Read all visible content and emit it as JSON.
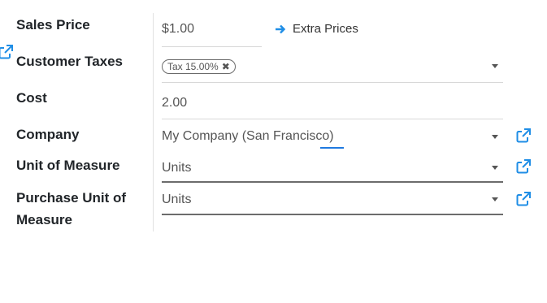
{
  "fields": {
    "sales_price": {
      "label": "Sales Price",
      "value": "$1.00"
    },
    "customer_taxes": {
      "label": "Customer Taxes",
      "tag": "Tax 15.00%"
    },
    "cost": {
      "label": "Cost",
      "value": "2.00"
    },
    "company": {
      "label": "Company",
      "value": "My Company (San Francisco)"
    },
    "unit_of_measure": {
      "label": "Unit of Measure",
      "value": "Units"
    },
    "purchase_uom": {
      "label_line1": "Purchase Unit of",
      "label_line2": "Measure",
      "value": "Units"
    }
  },
  "extra_prices": {
    "label": "Extra Prices"
  },
  "icons": {
    "external_link": "external-link-icon",
    "arrow_right": "arrow-right-icon",
    "dropdown": "caret-down-icon",
    "remove_tag": "close-icon"
  },
  "colors": {
    "accent": "#1f8ee6",
    "link_blue": "#1f7ae0"
  }
}
